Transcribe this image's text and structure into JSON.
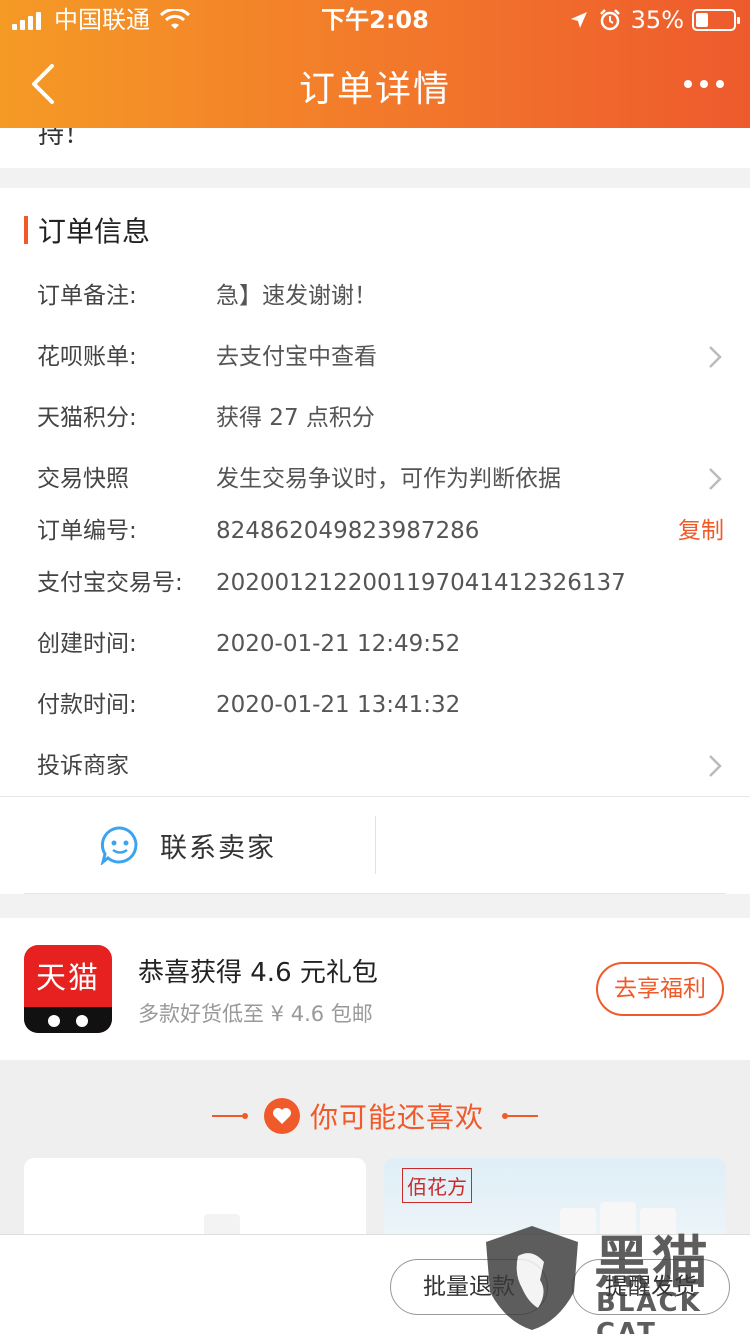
{
  "status_bar": {
    "carrier": "中国联通",
    "time": "下午2:08",
    "battery": "35%"
  },
  "nav": {
    "title": "订单详情"
  },
  "top_card": {
    "partial_text": "持！"
  },
  "order_info": {
    "title": "订单信息",
    "rows": [
      {
        "label": "订单备注:",
        "value": "急】速发谢谢！"
      },
      {
        "label": "花呗账单:",
        "value": "去支付宝中查看"
      },
      {
        "label": "天猫积分:",
        "value": "获得 27 点积分"
      },
      {
        "label": "交易快照",
        "value": "发生交易争议时，可作为判断依据"
      },
      {
        "label": "订单编号:",
        "value": "824862049823987286",
        "action": "复制"
      },
      {
        "label": "支付宝交易号:",
        "value": "2020012122001197041412326137"
      },
      {
        "label": "创建时间:",
        "value": "2020-01-21 12:49:52"
      },
      {
        "label": "付款时间:",
        "value": "2020-01-21 13:41:32"
      },
      {
        "label": "投诉商家",
        "value": ""
      }
    ],
    "contact_label": "联系卖家"
  },
  "promo": {
    "logo_text": "天猫",
    "title": "恭喜获得 4.6 元礼包",
    "subtitle": "多款好货低至 ¥ 4.6 包邮",
    "button": "去享福利"
  },
  "recommend": {
    "title": "你可能还喜欢",
    "brand": "佰花方"
  },
  "bottom_bar": {
    "refund_label": "批量退款",
    "remind_label": "提醒发货"
  },
  "watermark": {
    "cn": "黑猫",
    "en": "BLACK CAT"
  },
  "colors": {
    "accent": "#f05a2a",
    "header_start": "#f59a25",
    "header_end": "#ee5a2d",
    "tmall_red": "#e6211f"
  }
}
